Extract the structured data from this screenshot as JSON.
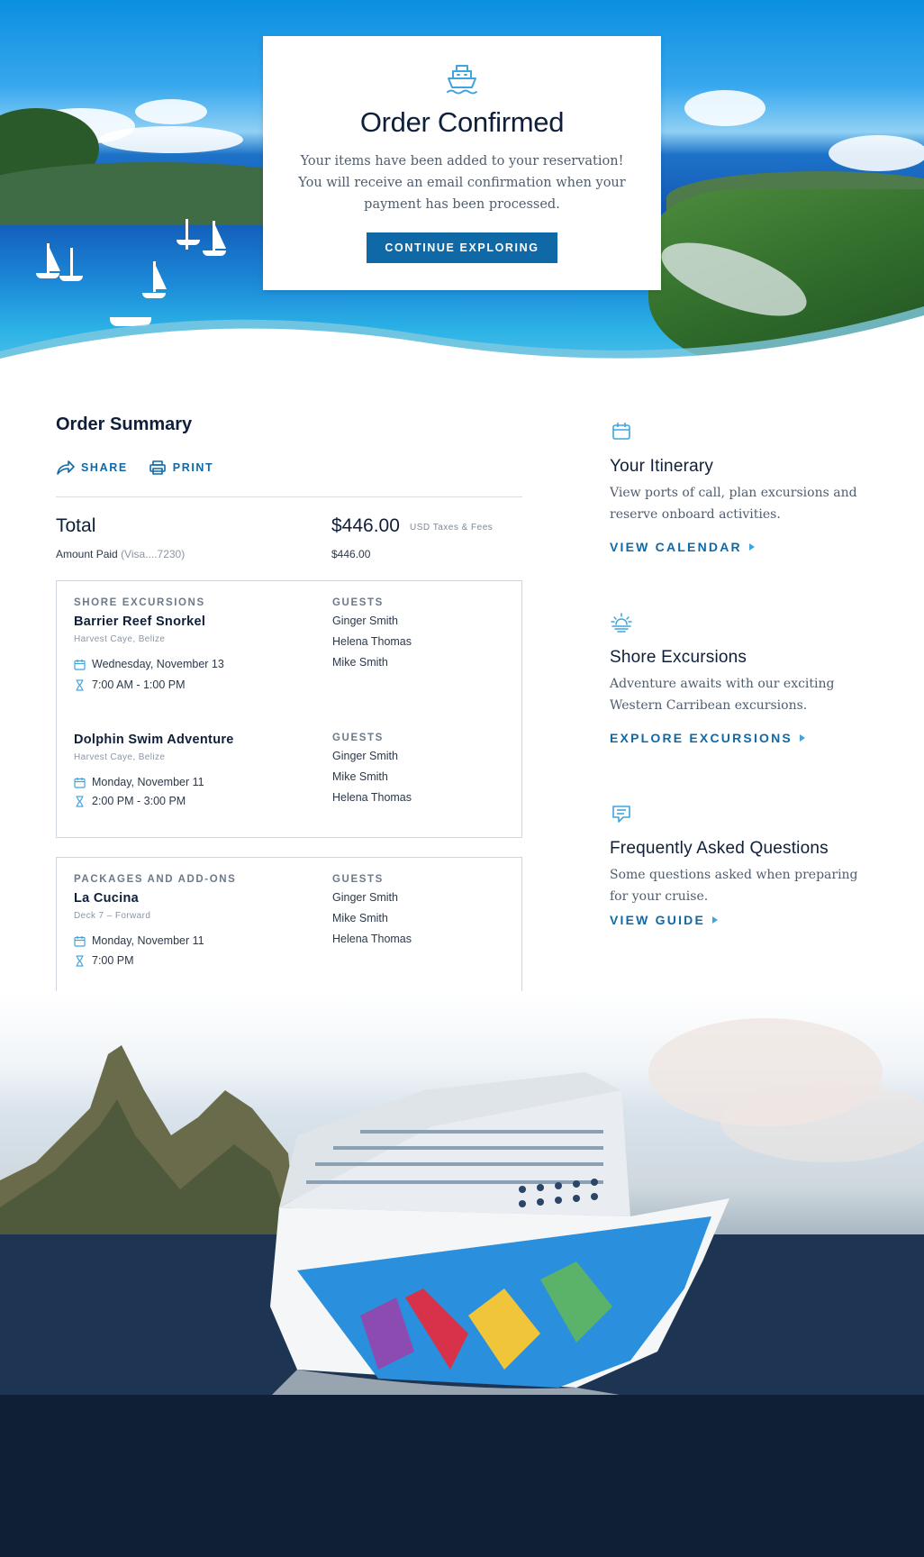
{
  "confirm": {
    "title": "Order Confirmed",
    "message": "Your items have been added to your reservation! You will receive an email confirmation when your payment has been processed.",
    "button": "CONTINUE EXPLORING"
  },
  "summary": {
    "title": "Order Summary",
    "share": "SHARE",
    "print": "PRINT",
    "total_label": "Total",
    "total_value": "$446.00",
    "total_note": "USD Taxes & Fees",
    "paid_label": "Amount Paid",
    "paid_card": "(Visa....7230)",
    "paid_value": "$446.00"
  },
  "shore": {
    "section_label": "SHORE EXCURSIONS",
    "guests_label": "GUESTS",
    "items": [
      {
        "title": "Barrier Reef Snorkel",
        "location": "Harvest Caye, Belize",
        "date": "Wednesday, November 13",
        "time": "7:00 AM - 1:00 PM",
        "guests": [
          "Ginger Smith",
          "Helena Thomas",
          "Mike Smith"
        ]
      },
      {
        "title": "Dolphin Swim Adventure",
        "location": "Harvest Caye, Belize",
        "date": "Monday, November 11",
        "time": "2:00 PM - 3:00 PM",
        "guests": [
          "Ginger Smith",
          "Mike Smith",
          "Helena Thomas"
        ]
      }
    ]
  },
  "packages": {
    "section_label": "PACKAGES AND ADD-ONS",
    "guests_label": "GUESTS",
    "item": {
      "title": "La Cucina",
      "location": "Deck 7 – Forward",
      "date": "Monday, November 11",
      "time": "7:00 PM",
      "guests": [
        "Ginger Smith",
        "Mike Smith",
        "Helena Thomas"
      ]
    }
  },
  "sidebar": [
    {
      "icon": "calendar-icon",
      "title": "Your Itinerary",
      "text": "View ports of call, plan excursions and reserve onboard activities.",
      "link": "VIEW CALENDAR"
    },
    {
      "icon": "sunrise-icon",
      "title": "Shore Excursions",
      "text": "Adventure awaits with our exciting Western Carribean excursions.",
      "link": "EXPLORE EXCURSIONS"
    },
    {
      "icon": "chat-icon",
      "title": "Frequently Asked Questions",
      "text": "Some questions asked when preparing for your cruise.",
      "link": "VIEW GUIDE"
    }
  ],
  "colors": {
    "primary": "#0f69a6",
    "accent": "#3fa5de",
    "text_dark": "#0f1f3a",
    "footer": "#0f1f36"
  }
}
